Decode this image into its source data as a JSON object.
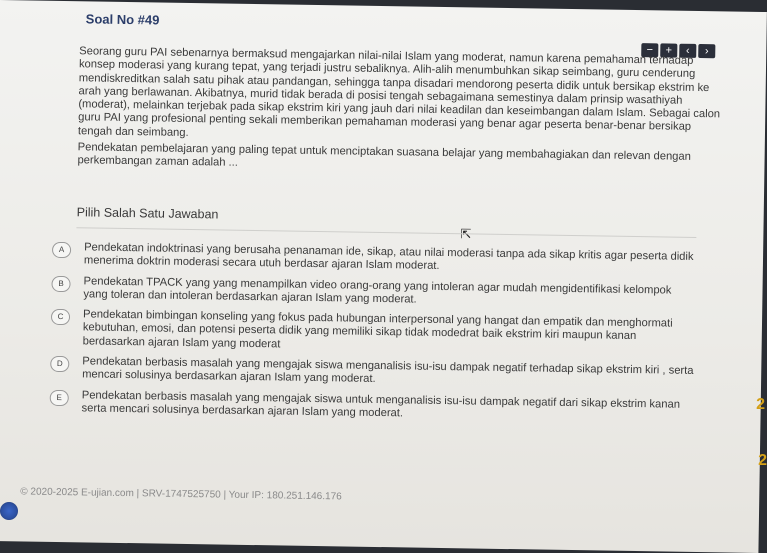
{
  "title": "Soal No #49",
  "nav": {
    "minus": "−",
    "plus": "+",
    "prev": "‹",
    "next": "›"
  },
  "question": {
    "body": "Seorang guru PAI sebenarnya bermaksud mengajarkan nilai-nilai Islam yang moderat, namun karena pemahaman terhadap konsep moderasi yang kurang tepat, yang terjadi justru sebaliknya. Alih-alih menumbuhkan sikap seimbang, guru cenderung mendiskreditkan salah satu pihak atau pandangan, sehingga tanpa disadari mendorong peserta didik untuk bersikap ekstrim ke arah yang berlawanan. Akibatnya, murid tidak berada di posisi tengah sebagaimana semestinya dalam prinsip wasathiyah (moderat), melainkan terjebak pada sikap ekstrim kiri yang jauh dari nilai keadilan dan keseimbangan dalam Islam. Sebagai calon guru PAI yang profesional penting sekali memberikan pemahaman moderasi yang benar agar peserta benar-benar bersikap tengah dan seimbang.",
    "closing": "Pendekatan pembelajaran yang paling tepat untuk menciptakan suasana belajar yang membahagiakan dan relevan dengan perkembangan zaman adalah ..."
  },
  "choose_label": "Pilih Salah Satu Jawaban",
  "options": [
    {
      "letter": "A",
      "text": "Pendekatan indoktrinasi yang berusaha penanaman ide, sikap, atau nilai moderasi tanpa ada sikap kritis agar peserta didik menerima doktrin moderasi secara utuh berdasar ajaran Islam moderat."
    },
    {
      "letter": "B",
      "text": "Pendekatan TPACK yang yang menampilkan video orang-orang yang intoleran agar mudah mengidentifikasi kelompok yang toleran dan intoleran berdasarkan ajaran Islam yang moderat."
    },
    {
      "letter": "C",
      "text": "Pendekatan bimbingan konseling yang fokus pada hubungan interpersonal yang hangat dan empatik dan menghormati kebutuhan, emosi, dan potensi peserta didik yang memiliki sikap tidak modedrat baik ekstrim kiri maupun kanan berdasarkan ajaran Islam yang moderat"
    },
    {
      "letter": "D",
      "text": "Pendekatan berbasis masalah yang mengajak siswa menganalisis isu-isu dampak negatif terhadap sikap ekstrim kiri , serta mencari solusinya berdasarkan ajaran Islam yang moderat."
    },
    {
      "letter": "E",
      "text": "Pendekatan berbasis masalah yang mengajak siswa untuk menganalisis isu-isu dampak negatif dari sikap ekstrim kanan serta mencari solusinya berdasarkan ajaran Islam yang moderat."
    }
  ],
  "footer": "© 2020-2025 E-ujian.com | SRV-1747525750 | Your IP: 180.251.146.176",
  "side_numbers": [
    "2",
    "2"
  ]
}
